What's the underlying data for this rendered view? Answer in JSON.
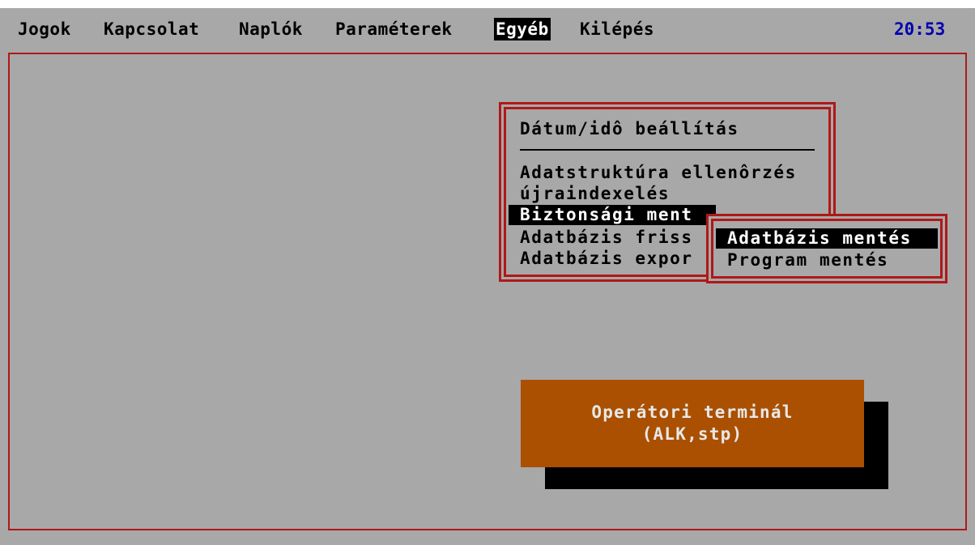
{
  "menubar": {
    "items": [
      {
        "label": "Jogok",
        "active": false
      },
      {
        "label": "Kapcsolat",
        "active": false
      },
      {
        "label": "Naplók",
        "active": false
      },
      {
        "label": "Paraméterek",
        "active": false
      },
      {
        "label": "Egyéb",
        "active": true
      },
      {
        "label": "Kilépés",
        "active": false
      }
    ],
    "clock": "20:53"
  },
  "dropdown": {
    "items": [
      {
        "label": "Dátum/idô beállítás"
      },
      {
        "label": "Adatstruktúra ellenôrzés"
      },
      {
        "label": "újraindexelés"
      },
      {
        "label": "Biztonsági ment",
        "selected": true
      },
      {
        "label": "Adatbázis friss"
      },
      {
        "label": "Adatbázis expor"
      }
    ]
  },
  "submenu": {
    "items": [
      {
        "label": "Adatbázis mentés",
        "selected": true
      },
      {
        "label": "Program mentés"
      }
    ]
  },
  "terminal": {
    "line1": "Operátori terminál",
    "line2": "(ALK,stp)"
  },
  "colors": {
    "background": "#a8a8a8",
    "frame": "#b01818",
    "clock": "#0000b0",
    "terminal_bg": "#aa5000"
  }
}
